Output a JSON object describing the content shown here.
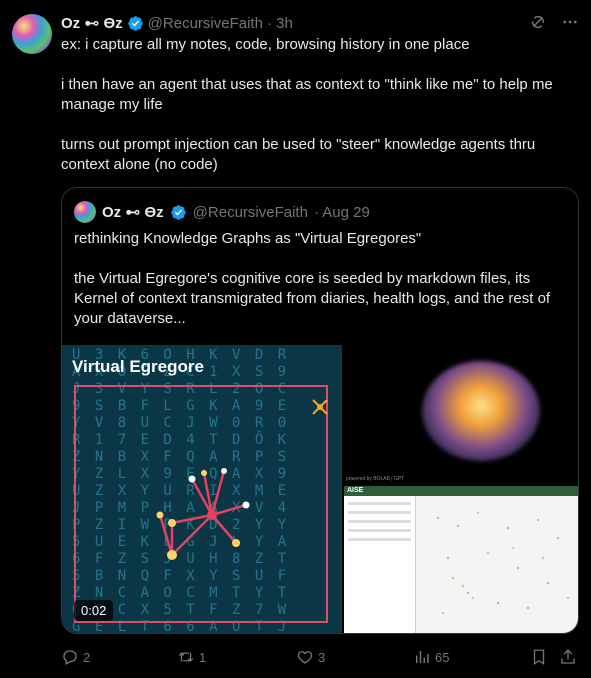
{
  "tweet": {
    "author_name": "Oz ⊷ ϴz",
    "handle": "@RecursiveFaith",
    "time": "· 3h",
    "paragraphs": [
      "ex: i capture all my notes, code, browsing history in one place",
      "i then have an agent that uses that as context to \"think like me\" to help me manage my life",
      "turns out prompt injection can be used to \"steer\" knowledge agents thru context alone (no code)"
    ]
  },
  "quote": {
    "author_name": "Oz ⊷ ϴz",
    "handle": "@RecursiveFaith",
    "time": "· Aug 29",
    "paragraphs": [
      "rethinking Knowledge Graphs as \"Virtual Egregores\"",
      "the Virtual Egregore's cognitive core is seeded by markdown files, its Kernel of context transmigrated from diaries, health logs, and the rest of your dataverse..."
    ],
    "media": {
      "video_title": "Virtual Egregore",
      "video_time": "0:02",
      "brain_caption": "powered by BOLAB | GPT",
      "map_logo": "AISE"
    }
  },
  "actions": {
    "replies": "2",
    "reposts": "1",
    "likes": "3",
    "views": "65"
  },
  "colors": {
    "verified": "#1d9bf0",
    "muted": "#71767b",
    "border": "#2f3336",
    "frame": "#e14b6a"
  },
  "icons": [
    "verified-badge-icon",
    "grok-icon",
    "more-icon",
    "reply-icon",
    "repost-icon",
    "like-icon",
    "views-icon",
    "bookmark-icon",
    "share-icon"
  ]
}
